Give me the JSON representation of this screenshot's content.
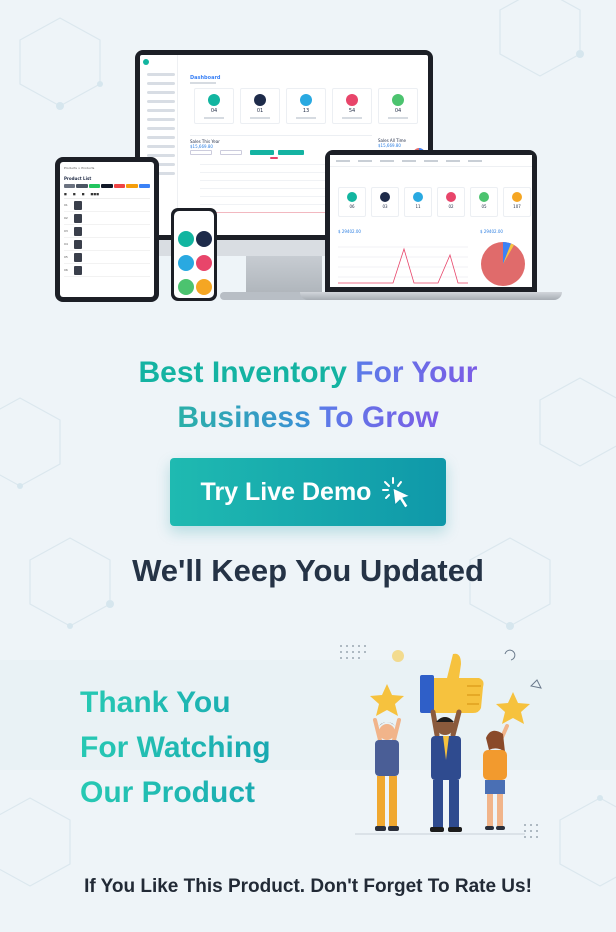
{
  "colors": {
    "background": "#eef4f8",
    "teal": "#14b3a2",
    "blue": "#3b8fd6",
    "purple": "#7b5ce6",
    "dark": "#253346",
    "button_start": "#1fbab1",
    "button_end": "#0f98a9"
  },
  "mockup": {
    "dashboard_title": "Dashboard",
    "stats": [
      {
        "value": "04",
        "color": "#12b5a0"
      },
      {
        "value": "01",
        "color": "#1e2b4a"
      },
      {
        "value": "13",
        "color": "#29a9e1"
      },
      {
        "value": "54",
        "color": "#e8456a"
      },
      {
        "value": "04",
        "color": "#4cc36f"
      }
    ],
    "sales_this_year_label": "Sales This Year",
    "sales_this_year_value": "$15,669.80",
    "sales_all_time_label": "Sales All Time",
    "sales_all_time_value": "$15,669.80",
    "laptop_stats": [
      {
        "value": "06",
        "color": "#12b5a0"
      },
      {
        "value": "03",
        "color": "#1e2b4a"
      },
      {
        "value": "11",
        "color": "#29a9e1"
      },
      {
        "value": "02",
        "color": "#e8456a"
      },
      {
        "value": "05",
        "color": "#4cc36f"
      },
      {
        "value": "107",
        "color": "#f5a623"
      }
    ],
    "laptop_sales_year": "$ 29402.00",
    "laptop_sales_all": "$ 29402.00",
    "tablet_breadcrumb": "Products > Products",
    "tablet_title": "Product List",
    "tablet_rows": [
      "01",
      "02",
      "03",
      "04",
      "05",
      "06"
    ]
  },
  "headline": {
    "line1_part1": "Best Inventory",
    "line1_part2": "For Your",
    "line2_part1": "Business",
    "line2_part2": "To Grow"
  },
  "demo_button": {
    "label": "Try Live Demo",
    "icon": "pointer-click-icon"
  },
  "updated_text": "We'll Keep You Updated",
  "thanks": {
    "line1": "Thank You",
    "line2": "For Watching",
    "line3": "Our Product"
  },
  "rate_text": "If You Like This Product. Don't Forget To Rate Us!"
}
